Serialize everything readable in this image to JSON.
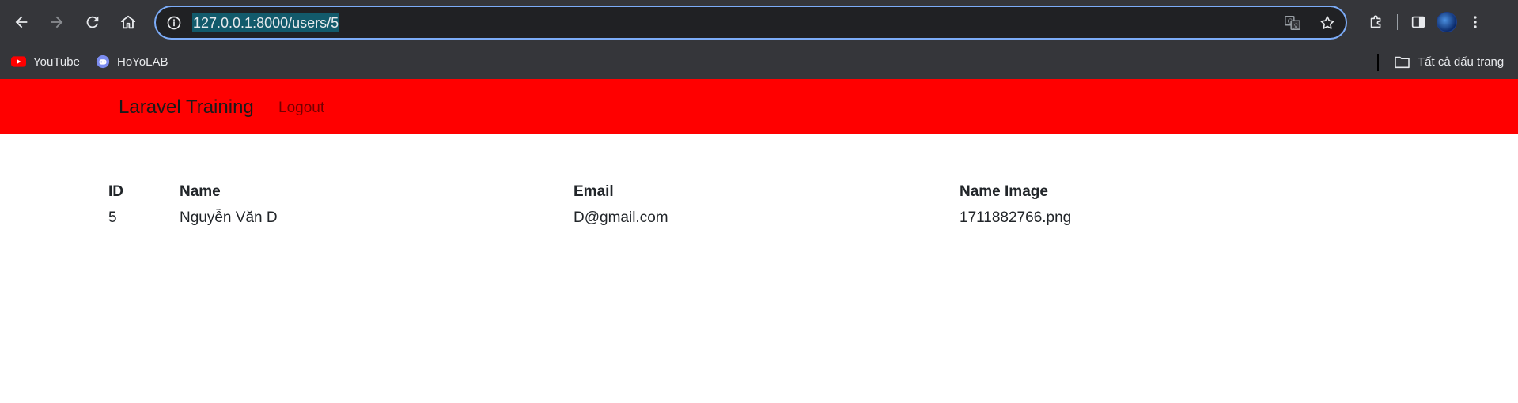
{
  "browser": {
    "url": "127.0.0.1:8000/users/5",
    "icons": {
      "back": "arrow-left-icon",
      "forward": "arrow-right-icon",
      "reload": "reload-icon",
      "home": "home-icon",
      "site_info": "info-icon",
      "translate": "translate-icon",
      "bookmark": "star-icon",
      "extensions": "puzzle-icon",
      "side_panel": "side-panel-icon",
      "menu": "kebab-menu-icon"
    }
  },
  "bookmarks": {
    "items": [
      {
        "label": "YouTube",
        "icon": "youtube-icon"
      },
      {
        "label": "HoYoLAB",
        "icon": "hoyolab-icon"
      }
    ],
    "all_bookmarks": "Tất cả dấu trang"
  },
  "navbar": {
    "brand": "Laravel Training",
    "logout": "Logout",
    "color": "#ff0000"
  },
  "user_table": {
    "headers": {
      "id": "ID",
      "name": "Name",
      "email": "Email",
      "name_image": "Name Image"
    },
    "row": {
      "id": "5",
      "name": "Nguyễn Văn D",
      "email": "D@gmail.com",
      "name_image": "1711882766.png"
    }
  }
}
